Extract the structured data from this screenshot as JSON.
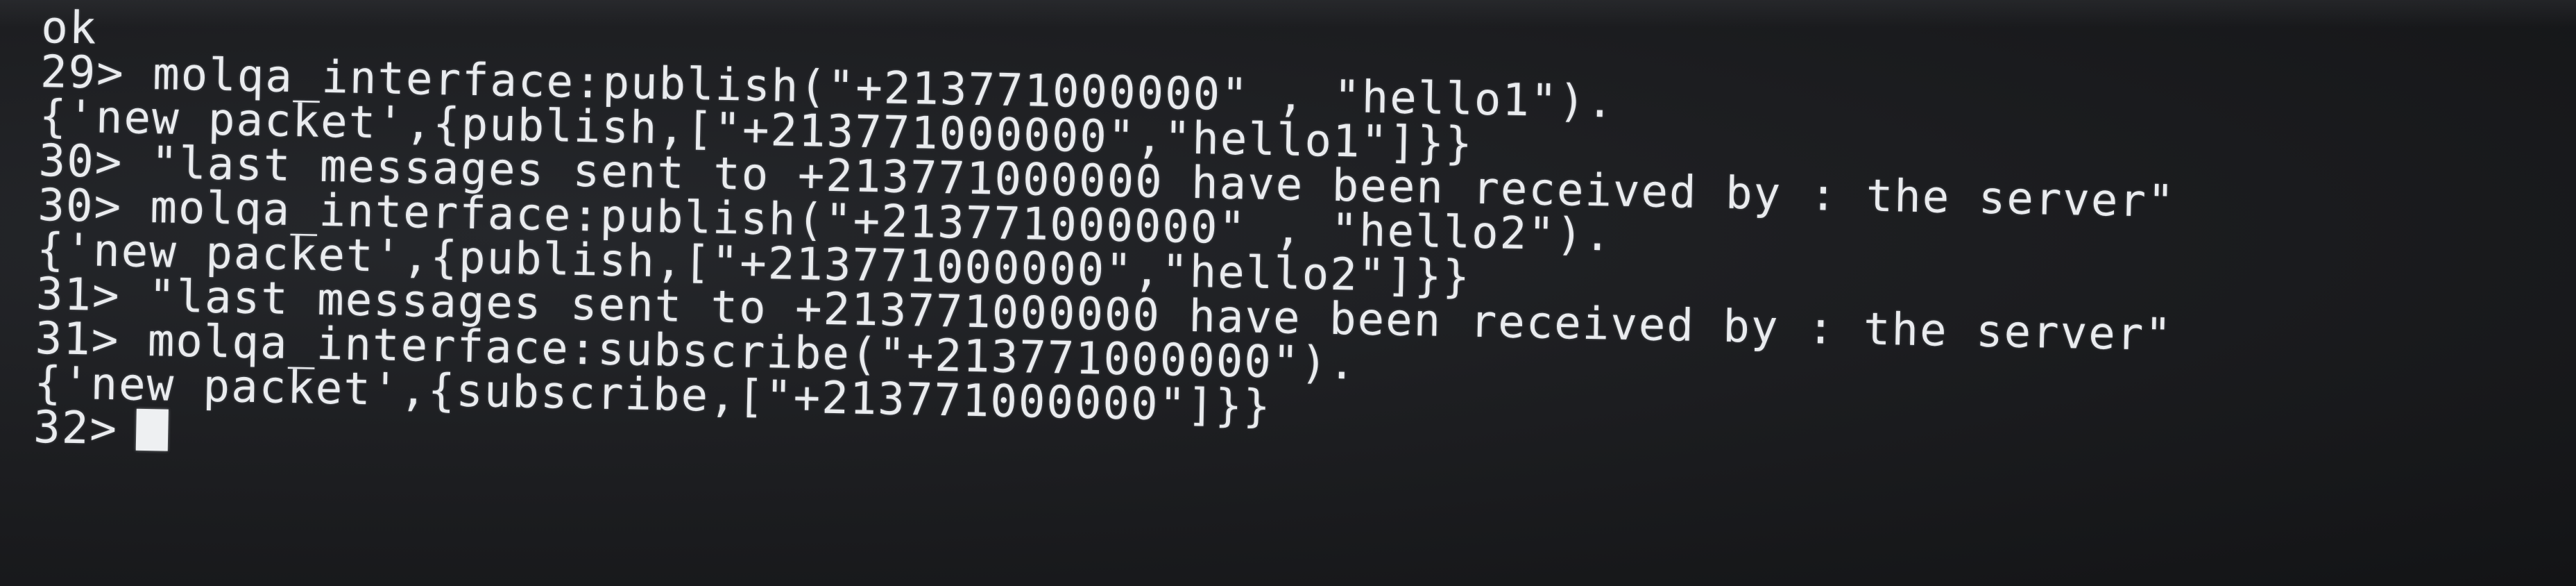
{
  "terminal": {
    "lines": [
      "ok",
      "29> molqa_interface:publish(\"+213771000000\" , \"hello1\").",
      "{'new packet',{publish,[\"+213771000000\",\"hello1\"]}}",
      "30> \"last messages sent to +213771000000 have been received by : the server\"",
      "30> molqa_interface:publish(\"+213771000000\" , \"hello2\").",
      "{'new packet',{publish,[\"+213771000000\",\"hello2\"]}}",
      "31> \"last messages sent to +213771000000 have been received by : the server\"",
      "31> molqa_interface:subscribe(\"+213771000000\").",
      "{'new packet',{subscribe,[\"+213771000000\"]}}"
    ],
    "prompt": "32>"
  }
}
